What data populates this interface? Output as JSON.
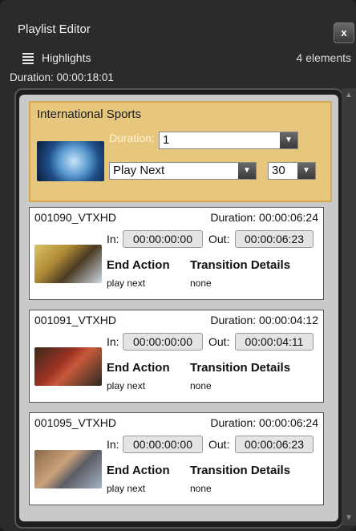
{
  "window": {
    "title": "Playlist Editor",
    "close_label": "x"
  },
  "playlist": {
    "name": "Highlights",
    "element_count": "4 elements",
    "duration": "Duration: 00:00:18:01"
  },
  "group": {
    "title": "International Sports",
    "duration_label": "Duration:",
    "duration_value": "1",
    "action_value": "Play Next",
    "number_value": "30"
  },
  "clips": [
    {
      "id": "001090_VTXHD",
      "duration": "Duration:  00:00:06:24",
      "in_label": "In:",
      "in_value": "00:00:00:00",
      "out_label": "Out:",
      "out_value": "00:00:06:23",
      "end_action_label": "End Action",
      "end_action_value": "play next",
      "transition_label": "Transition Details",
      "transition_value": "none",
      "thumb": "cyclist-yellow"
    },
    {
      "id": "001091_VTXHD",
      "duration": "Duration:  00:00:04:12",
      "in_label": "In:",
      "in_value": "00:00:00:00",
      "out_label": "Out:",
      "out_value": "00:00:04:11",
      "end_action_label": "End Action",
      "end_action_value": "play next",
      "transition_label": "Transition Details",
      "transition_value": "none",
      "thumb": "cyclists-red"
    },
    {
      "id": "001095_VTXHD",
      "duration": "Duration:  00:00:06:24",
      "in_label": "In:",
      "in_value": "00:00:00:00",
      "out_label": "Out:",
      "out_value": "00:00:06:23",
      "end_action_label": "End Action",
      "end_action_value": "play next",
      "transition_label": "Transition Details",
      "transition_value": "none",
      "thumb": "cyclists-road"
    }
  ],
  "icons": {
    "menu": "list-icon",
    "close": "close-icon",
    "dropdown": "chevron-down-icon",
    "scroll_up": "scroll-up-icon",
    "scroll_down": "scroll-down-icon"
  },
  "colors": {
    "window_bg": "#2b2b2b",
    "group_bg": "#e7c77e",
    "list_bg": "#c9c9c9",
    "clip_bg": "#ffffff"
  }
}
